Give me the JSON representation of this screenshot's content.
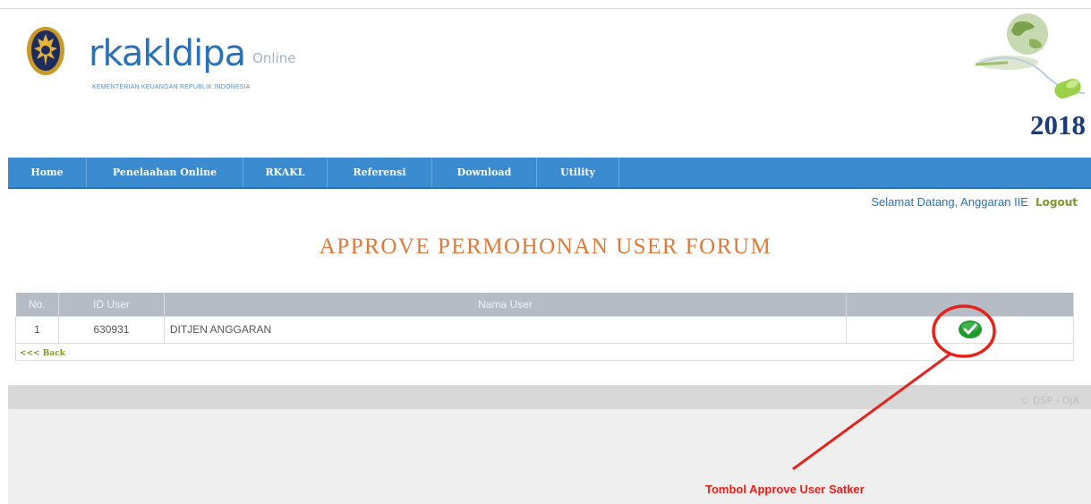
{
  "header": {
    "brand_name": "rkakldipa",
    "brand_suffix": "Online",
    "tagline": "KEMENTERIAN KEUANGAN REPUBLIK INDONESIA",
    "year": "2018"
  },
  "nav": {
    "items": [
      "Home",
      "Penelaahan Online",
      "RKAKL",
      "Referensi",
      "Download",
      "Utility"
    ]
  },
  "user_bar": {
    "welcome": "Selamat Datang, Anggaran IIE",
    "logout": "Logout"
  },
  "page": {
    "title": "APPROVE PERMOHONAN USER FORUM"
  },
  "table": {
    "headers": [
      "No.",
      "ID User",
      "Nama User",
      ""
    ],
    "rows": [
      {
        "no": "1",
        "id_user": "630931",
        "nama_user": "DITJEN ANGGARAN",
        "action_icon": "approve-check-icon"
      }
    ],
    "back_label": "<<< Back"
  },
  "footer": {
    "copyright": "© DSP - DJA"
  },
  "annotation": {
    "label": "Tombol Approve User Satker",
    "color": "#e8211b"
  },
  "colors": {
    "nav_bg": "#3b8bd0",
    "title": "#e0793a",
    "brand": "#2a71b8",
    "year": "#1a3c7a"
  }
}
